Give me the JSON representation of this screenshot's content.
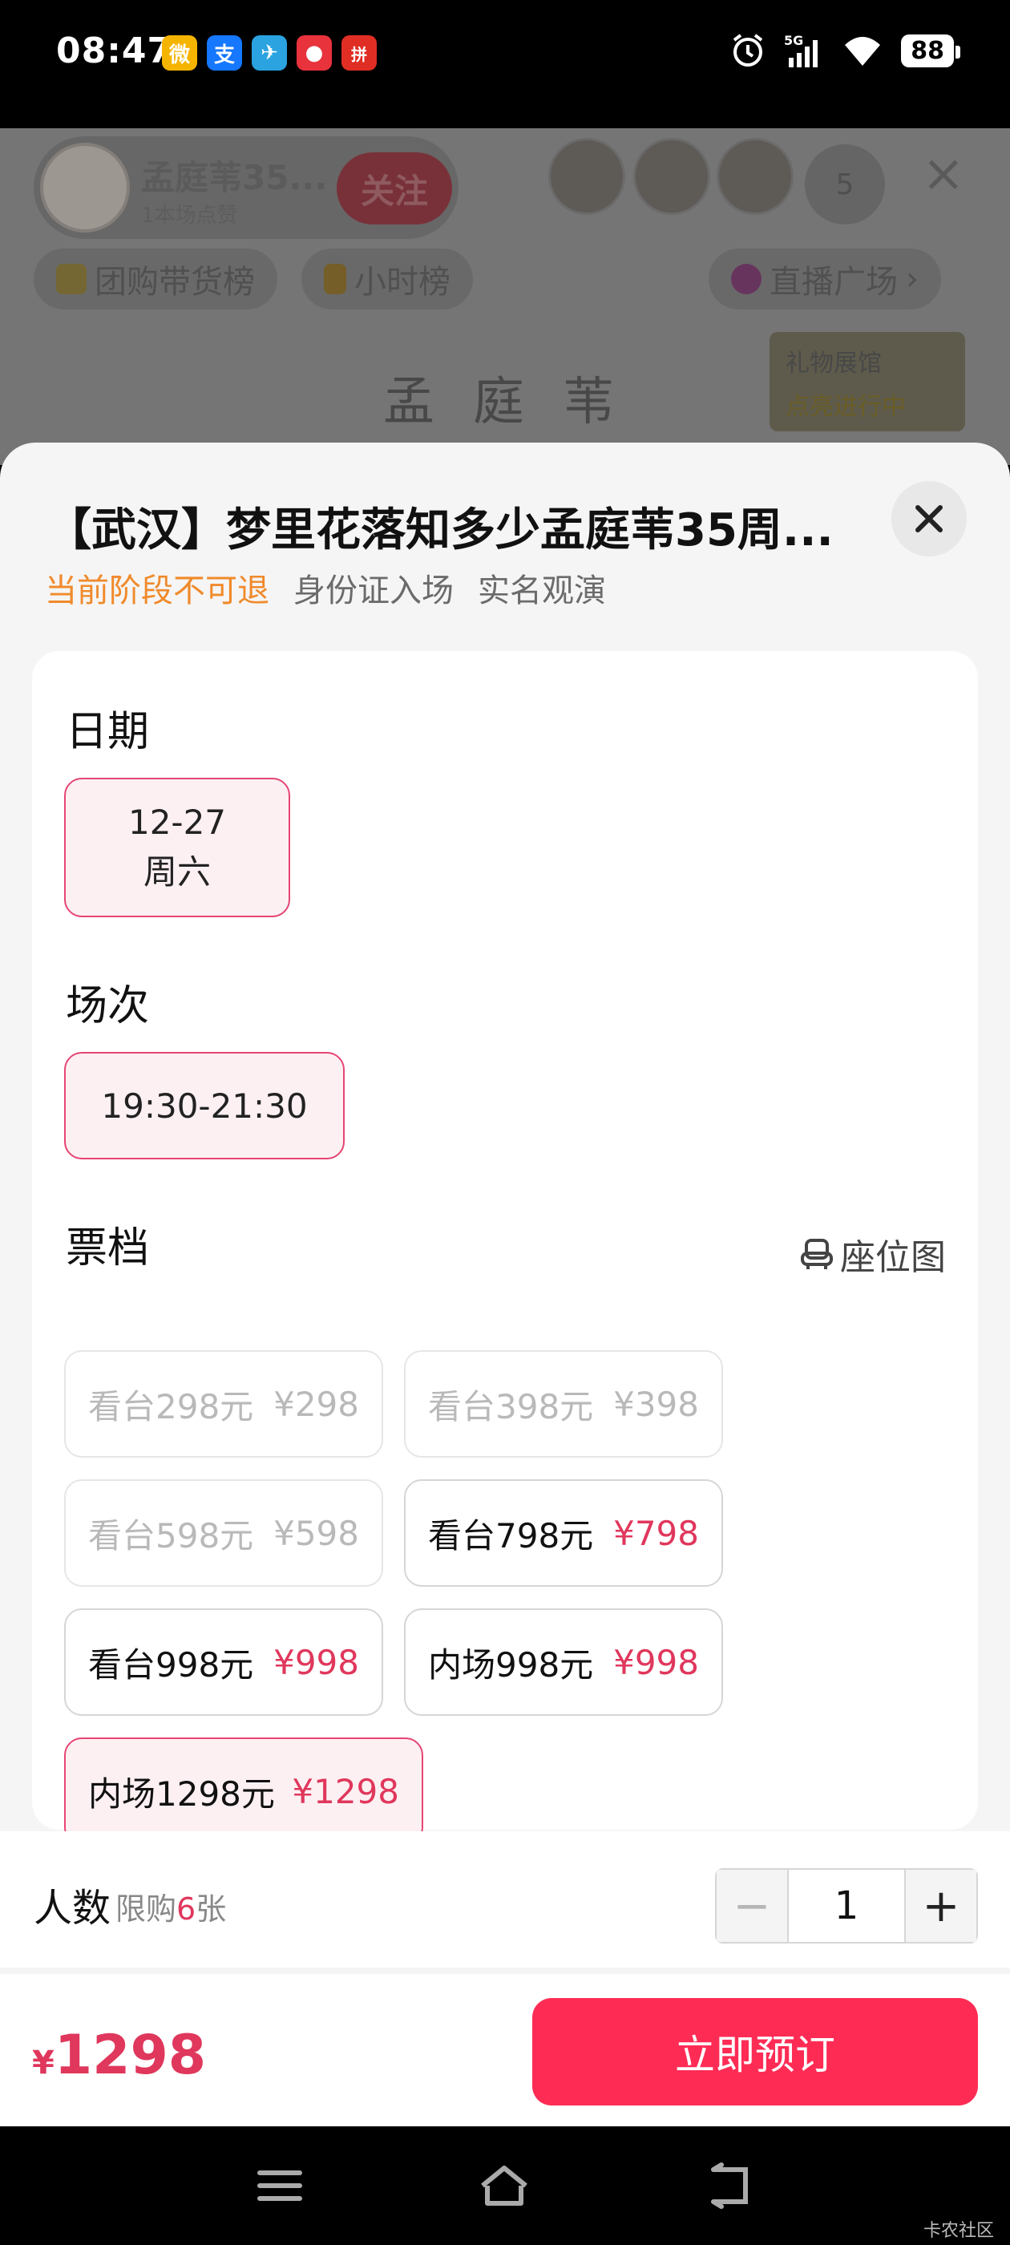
{
  "status_bar": {
    "time": "08:47",
    "apps": [
      {
        "icon": "weibo-icon",
        "color": "#f5b400",
        "glyph": "微"
      },
      {
        "icon": "alipay-icon",
        "color": "#1677ff",
        "glyph": "支"
      },
      {
        "icon": "telegram-icon",
        "color": "#2aa3e0",
        "glyph": "✈"
      },
      {
        "icon": "rednote-icon",
        "color": "#e8323c",
        "glyph": "●"
      },
      {
        "icon": "pinduoduo-icon",
        "color": "#e02e24",
        "glyph": "拼"
      }
    ],
    "network": "5G",
    "battery": "88"
  },
  "live_room": {
    "host_name": "孟庭苇35...",
    "host_sub": "1本场点赞",
    "follow_label": "关注",
    "viewer_count": "5",
    "chip_group_buy": "团购带货榜",
    "chip_hourly": "小时榜",
    "chip_plaza": "直播广场",
    "stage_title": "孟庭苇",
    "gift_box_title": "礼物展馆",
    "gift_box_sub": "点亮进行中"
  },
  "sheet": {
    "title": "【武汉】梦里花落知多少孟庭苇35周...",
    "tags": [
      "当前阶段不可退",
      "身份证入场",
      "实名观演"
    ],
    "date_label": "日期",
    "date_option": {
      "date": "12-27",
      "weekday": "周六"
    },
    "session_label": "场次",
    "session_option": "19:30-21:30",
    "tier_label": "票档",
    "seat_map_label": "座位图",
    "tiers": [
      {
        "name": "看台298元",
        "price": "¥298",
        "state": "disabled"
      },
      {
        "name": "看台398元",
        "price": "¥398",
        "state": "disabled"
      },
      {
        "name": "看台598元",
        "price": "¥598",
        "state": "disabled"
      },
      {
        "name": "看台798元",
        "price": "¥798",
        "state": "available"
      },
      {
        "name": "看台998元",
        "price": "¥998",
        "state": "available"
      },
      {
        "name": "内场998元",
        "price": "¥998",
        "state": "available"
      },
      {
        "name": "内场1298元",
        "price": "¥1298",
        "state": "selected"
      }
    ],
    "quantity": {
      "label": "人数",
      "limit_prefix": "限购",
      "limit_num": "6",
      "limit_suffix": "张",
      "minus": "−",
      "value": "1",
      "plus": "+"
    },
    "total": {
      "currency": "¥",
      "amount": "1298"
    },
    "book_label": "立即预订"
  },
  "watermark": "卡农社区",
  "colors": {
    "accent": "#fe2c55",
    "price": "#e0375c",
    "warn": "#f08a2c"
  }
}
